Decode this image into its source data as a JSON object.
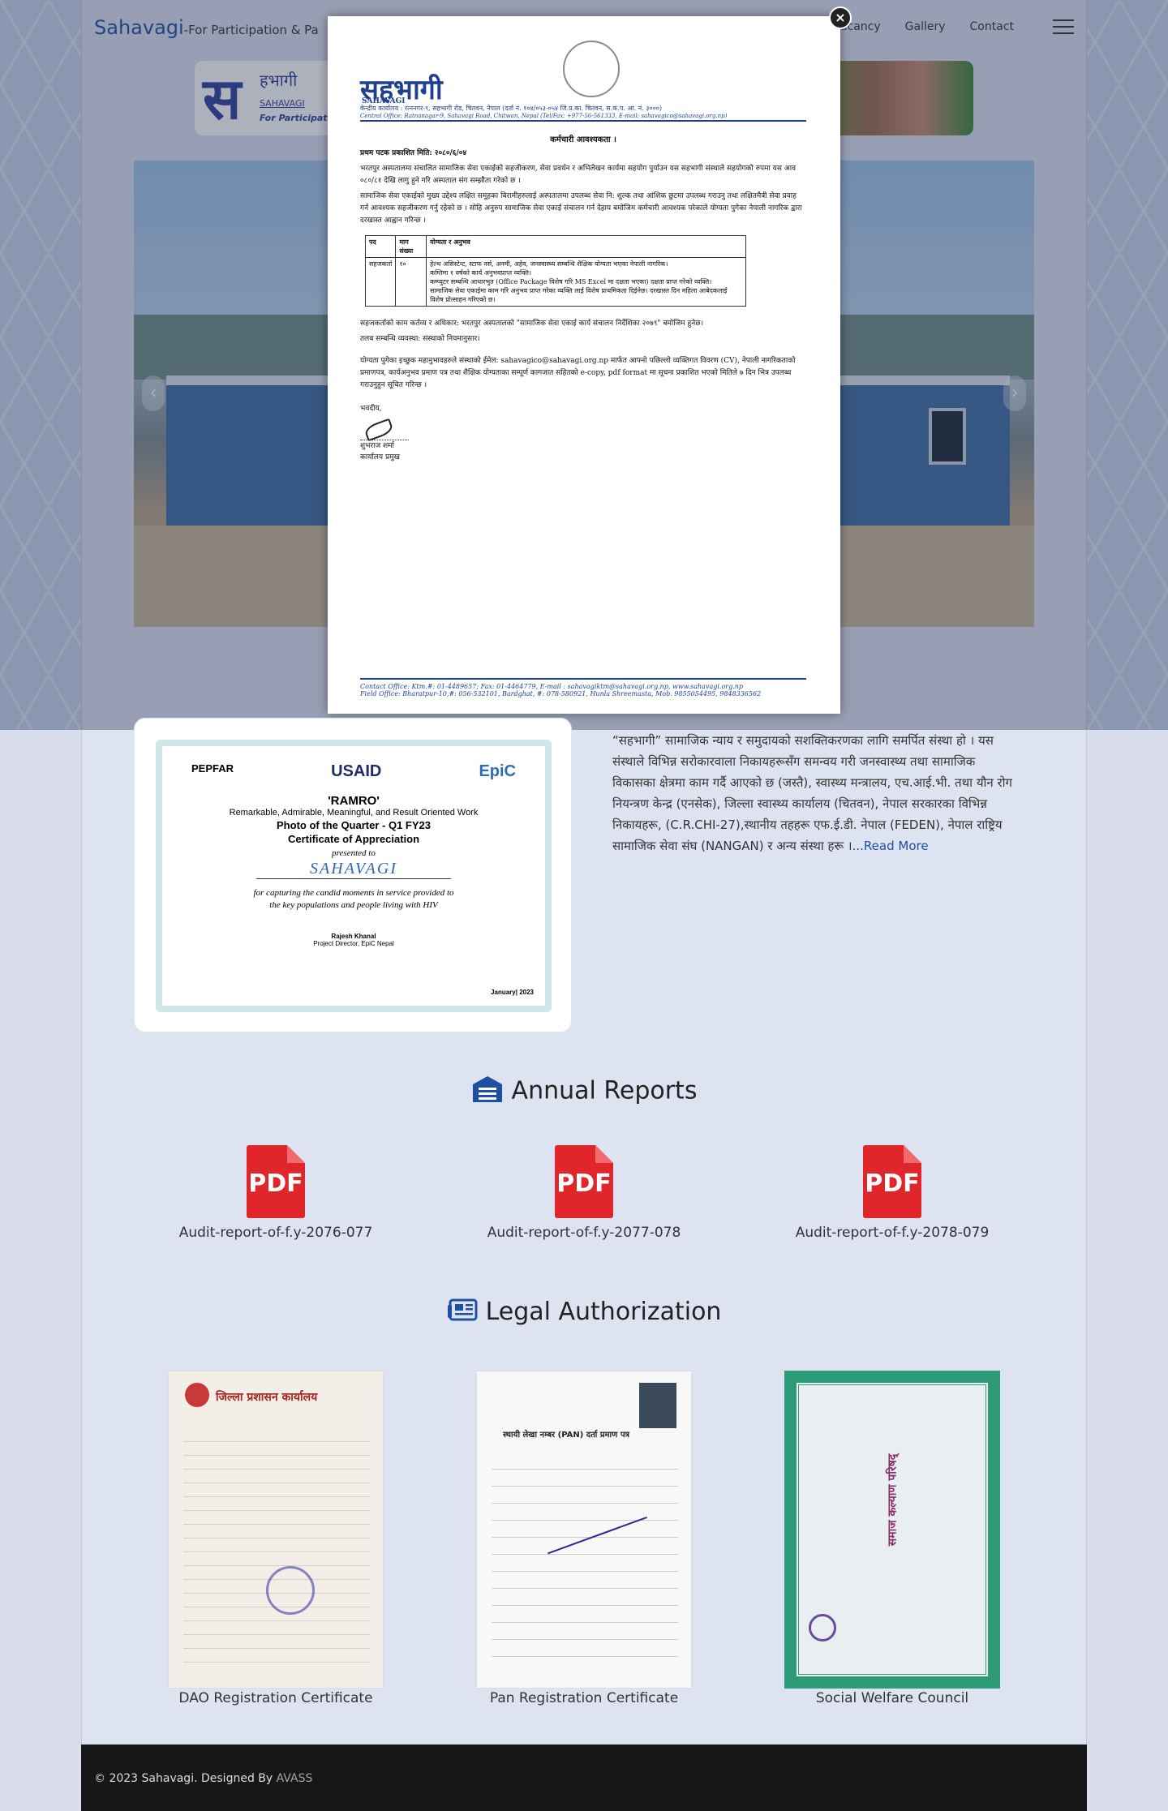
{
  "navbar": {
    "brand": "Sahavagi",
    "tagline": "-For Participation & Pa",
    "links": [
      "Vacancy",
      "Gallery",
      "Contact"
    ]
  },
  "banner": {
    "logo_main": "स",
    "logo_sub": "हभागी",
    "logo_en": "SAHAVAGI",
    "logo_tag": "For Participation"
  },
  "modal": {
    "close_glyph": "×",
    "doc": {
      "logo": "सहभागी",
      "logo_en": "SAHAVAGI",
      "address_ne": "केन्द्रीय कार्यालय : रत्ननगर-९, सहभागी रोड, चितवन, नेपाल (दर्ता नं. १०४/०५३-०५४ जि.प्र.का. चितवन, स.क.प. आ. नं. ३०००)",
      "address_en": "Central Office: Ratnanagar-9, Sahavagi Road, Chitwan, Nepal (Tel/Fax: +977-56-561333, E-mail: sahavagico@sahavagi.org.np)",
      "title": "कर्मचारी आवश्यकता ।",
      "published": "प्रथम पटक प्रकाशित मिति: २०८०/६/०४",
      "para1": "भरतपुर अस्पतालमा संचालित सामाजिक सेवा एकाईको सहजीकरण, सेवा प्रवर्धन र अभिलेखन कार्यमा सहयोग पुर्याउन यस सहभागी संस्थाले सहयोगको रुपमा यस आव ०८०/८१ देखि लागु हुने गरि अस्पताल संग सम्झौता गरेको छ ।",
      "para2": "सामाजिक सेवा एकाईको मुख्य उद्देश्य लक्षित समूहका बिरामीहरुलाई अस्पतालमा उपलब्ध सेवा नि: शुल्क तथा आंशिक छुटमा उपलब्ध गराउनु तथा लक्षितमैत्री सेवा प्रवाह गर्न आवश्यक सहजीकरण गर्नु रहेको छ । सोहि अनुरुप सामाजिक सेवा एकाई संचालन गर्न देहाय बमोजिम कर्मचारी आवश्यक परेकाले योग्यता पुगेका नेपाली नागरिक द्वारा दरखास्त आह्वान गरिन्छ ।",
      "table_headers": [
        "पद",
        "माग संख्या",
        "योग्यता र अनुभव"
      ],
      "table_row": {
        "post": "सहजकर्ता",
        "count": "१०",
        "qualifications": [
          "हेल्थ असिस्टेन्ट, स्टाफ नर्स, अनमी, अहेव, जनस्वास्थ्य सम्बन्धि शैक्षिक योग्यता भएका नेपाली नागरिक।",
          "कम्तिमा १ वर्षको कार्य अनुभवप्राप्त व्यक्ति।",
          "कम्प्युटर सम्बन्धि आधारभुत (Office Package विशेष गरि MS Excel मा दक्षता भएका) दक्षता प्राप्त गरेको व्यक्ति।",
          "सामाजिक सेवा एकाईमा काम गरि अनुभव प्राप्त गरेका व्यक्ति लाई विशेष प्राथमिकता दिईनेछ। दरखास्त दिन महिला आबेदकलाई विशेष प्रोत्साहन गरिएको छ।"
        ]
      },
      "duty": "सहजकर्ताको काम कर्तव्य र अधिकार: भरतपुर अस्पतालको \"सामाजिक सेवा एकाई कार्य संचालन निर्देशिका २०७९\" बमोजिम हुनेछ।",
      "salary": "तलब सम्बन्धि व्यवस्था: संस्थाको नियमानुसार।",
      "apply": "योग्यता पुगेका इच्छुक महानुभावहरुले संस्थाको ईमेल: sahavagico@sahavagi.org.np मार्फत आफ्नो पछिल्लो व्यक्तिगत विवरण (CV), नेपाली नागरिकताको प्रमाणपत्र, कार्यअनुभव प्रमाण पत्र तथा शैक्षिक योग्यताका सम्पूर्ण कागजात सहितको e-copy, pdf format मा सूचना प्रकाशित भएको मितिले ७ दिन भित्र उपलब्ध गराउनुहुन सूचित गरिन्छ ।",
      "regards": "भवदीय,",
      "signer": "शुभराज शर्मा",
      "signer_title": "कार्यालय प्रमुख",
      "footer1": "Contact Office: Ktm.#: 01-4489657; Fax: 01-4464779, E-mail : sahavagiktm@sahavagi.org.np, www.sahavagi.org.np",
      "footer2": "Field Office: Bharatpur-10,#: 056-532101, Bardghat, #: 078-580921, Hunla Shreemasta, Mob. 9855054495, 9848336562"
    }
  },
  "certificate": {
    "logo1": "PEPFAR",
    "logo2": "USAID",
    "logo3": "EpiC",
    "ramro": "'RAMRO'",
    "sub": "Remarkable, Admirable, Meaningful, and Result Oriented Work",
    "photo": "Photo of the  Quarter - Q1 FY23",
    "cert_of": "Certificate of Appreciation",
    "presented": "presented to",
    "name": "SAHAVAGI",
    "for_line1": "for capturing the candid moments in service provided to",
    "for_line2": "the key populations and people living with HIV",
    "signer": "Rajesh Khanal",
    "signer_title": "Project Director, EpiC Nepal",
    "date": "January| 2023"
  },
  "about": {
    "text": "“सहभागी” सामाजिक न्याय र समुदायको सशक्तिकरणका लागि समर्पित संस्था हो । यस संस्थाले विभिन्न सरोकारवाला निकायहरूसँग समन्वय गरी जनस्वास्थ्य तथा सामाजिक विकासका क्षेत्रमा काम गर्दै आएको छ (जस्तै), स्वास्थ्य मन्त्रालय, एच.आई.भी. तथा यौन रोग नियन्त्रण केन्द्र (एनसेक), जिल्ला स्वास्थ्य कार्यालय (चितवन), नेपाल सरकारका विभिन्न निकायहरू, (C.R.CHI-27),स्थानीय तहहरू एफ.ई.डी. नेपाल (FEDEN), नेपाल राष्ट्रिय सामाजिक सेवा संघ (NANGAN) र अन्य संस्था हरू ।",
    "read_more": "...Read More"
  },
  "annual_reports": {
    "title": "Annual Reports",
    "items": [
      {
        "label": "Audit-report-of-f.y-2076-077",
        "icon_text": "PDF"
      },
      {
        "label": "Audit-report-of-f.y-2077-078",
        "icon_text": "PDF"
      },
      {
        "label": "Audit-report-of-f.y-2078-079",
        "icon_text": "PDF"
      }
    ]
  },
  "legal": {
    "title": "Legal Authorization",
    "items": [
      {
        "label": "DAO Registration Certificate",
        "heading": "जिल्ला प्रशासन कार्यालय"
      },
      {
        "label": "Pan Registration Certificate",
        "heading": "स्थायी लेखा नम्बर (PAN) दर्ता प्रमाण पत्र"
      },
      {
        "label": "Social Welfare Council",
        "heading": "समाज कल्याण परिषद्"
      }
    ]
  },
  "footer": {
    "text": "© 2023 Sahavagi. Designed By ",
    "link": "AVASS"
  },
  "colors": {
    "brand": "#1f4fa3",
    "pdf_red": "#e0262a",
    "footer_bg": "#171717"
  }
}
